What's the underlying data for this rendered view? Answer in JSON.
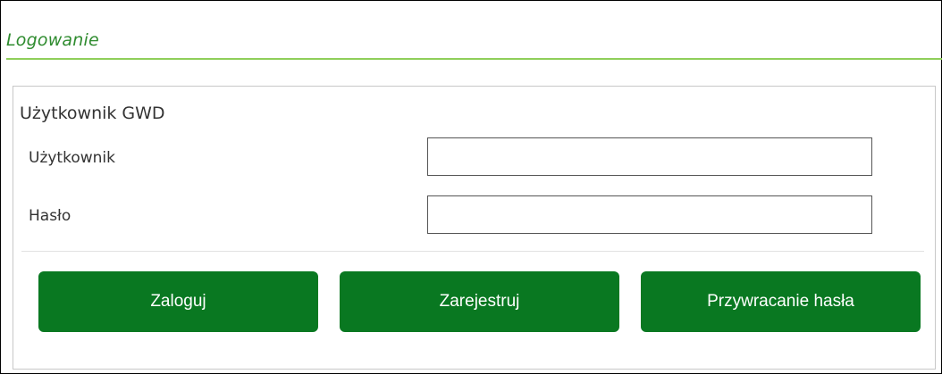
{
  "page": {
    "title": "Logowanie"
  },
  "login_panel": {
    "heading": "Użytkownik GWD",
    "fields": {
      "username": {
        "label": "Użytkownik",
        "value": "",
        "placeholder": ""
      },
      "password": {
        "label": "Hasło",
        "value": "",
        "placeholder": ""
      }
    },
    "buttons": {
      "login": "Zaloguj",
      "register": "Zarejestruj",
      "reset_password": "Przywracanie hasła"
    }
  },
  "colors": {
    "title_text": "#2e8b2e",
    "title_rule": "#8fcf5a",
    "button_bg": "#097821",
    "button_text": "#ffffff",
    "panel_border": "#c8c8c8"
  }
}
